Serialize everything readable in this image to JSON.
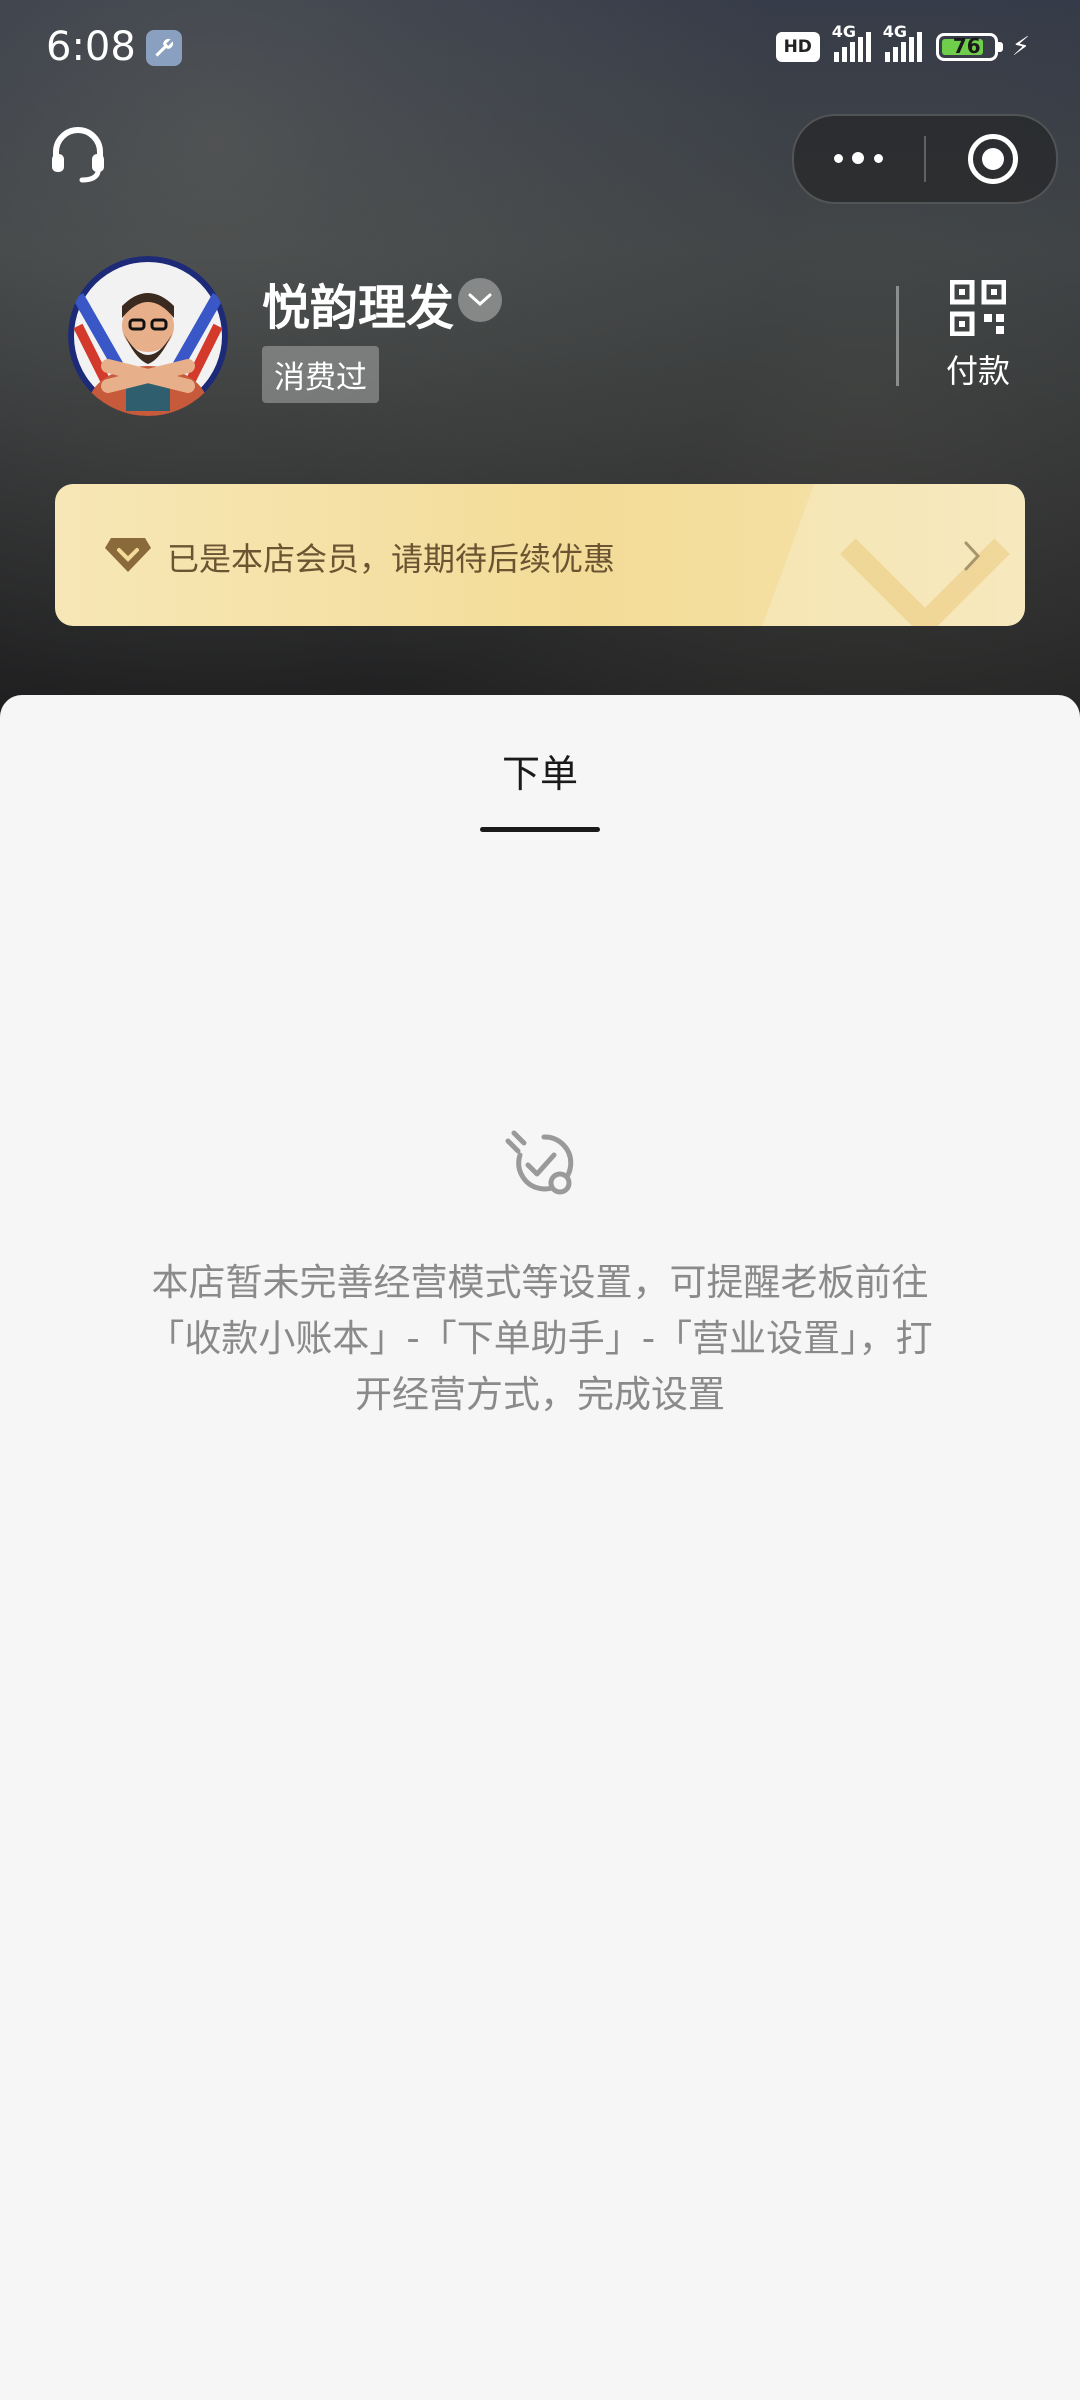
{
  "status_bar": {
    "time": "6:08",
    "network_badge": "HD",
    "signal_1_label": "4G",
    "signal_2_label": "4G",
    "battery_level": "76",
    "charging": true
  },
  "header": {
    "shop_name": "悦韵理发",
    "badge": "消费过",
    "pay_label": "付款"
  },
  "member_banner": {
    "text": "已是本店会员，请期待后续优惠"
  },
  "tabs": [
    {
      "label": "下单",
      "active": true
    }
  ],
  "empty_state": {
    "message": "本店暂未完善经营模式等设置，可提醒老板前往「收款小账本」-「下单助手」-「营业设置」，打开经营方式，完成设置"
  },
  "colors": {
    "accent": "#1a1a1a",
    "member_gold": "#f3dc98",
    "battery_green": "#6fcf4b"
  }
}
